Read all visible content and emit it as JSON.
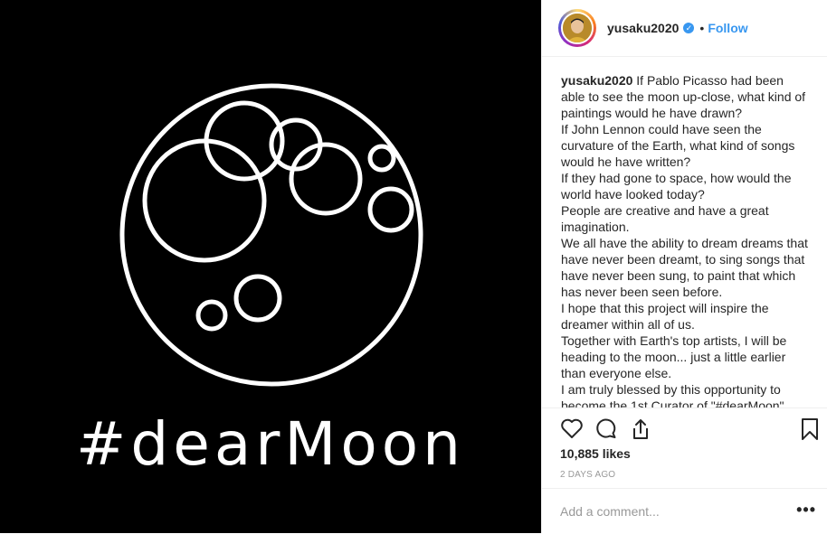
{
  "post": {
    "hashtag": "#dearMoon"
  },
  "header": {
    "username": "yusaku2020",
    "separator": "•",
    "follow_label": "Follow",
    "verified_glyph": "✓"
  },
  "caption": {
    "username": "yusaku2020",
    "lines": [
      "If Pablo Picasso had been able to see the moon up-close, what kind of paintings would he have drawn?",
      "If John Lennon could have seen the curvature of the Earth, what kind of songs would he have written?",
      "If they had gone to space, how would the world have looked today?",
      "People are creative and have a great imagination.",
      "We all have the ability to dream dreams that have never been dreamt, to sing songs that have never been sung, to paint that which has never been seen before.",
      "I hope that this project will inspire the dreamer within all of us.",
      "Together with Earth's top artists, I will be heading to the moon... just a little earlier than everyone else.",
      "I am truly blessed by this opportunity to",
      "become the 1st Curator of \"#dearMoon\""
    ]
  },
  "stats": {
    "likes": "10,885 likes",
    "time": "2 DAYS AGO"
  },
  "comment": {
    "placeholder": "Add a comment...",
    "more": "•••"
  },
  "icons": {
    "like": "heart-icon",
    "comment": "comment-icon",
    "share": "share-icon",
    "save": "bookmark-icon",
    "verified": "verified-badge-icon"
  },
  "colors": {
    "link": "#3897f0",
    "text": "#262626",
    "muted": "#999999"
  }
}
